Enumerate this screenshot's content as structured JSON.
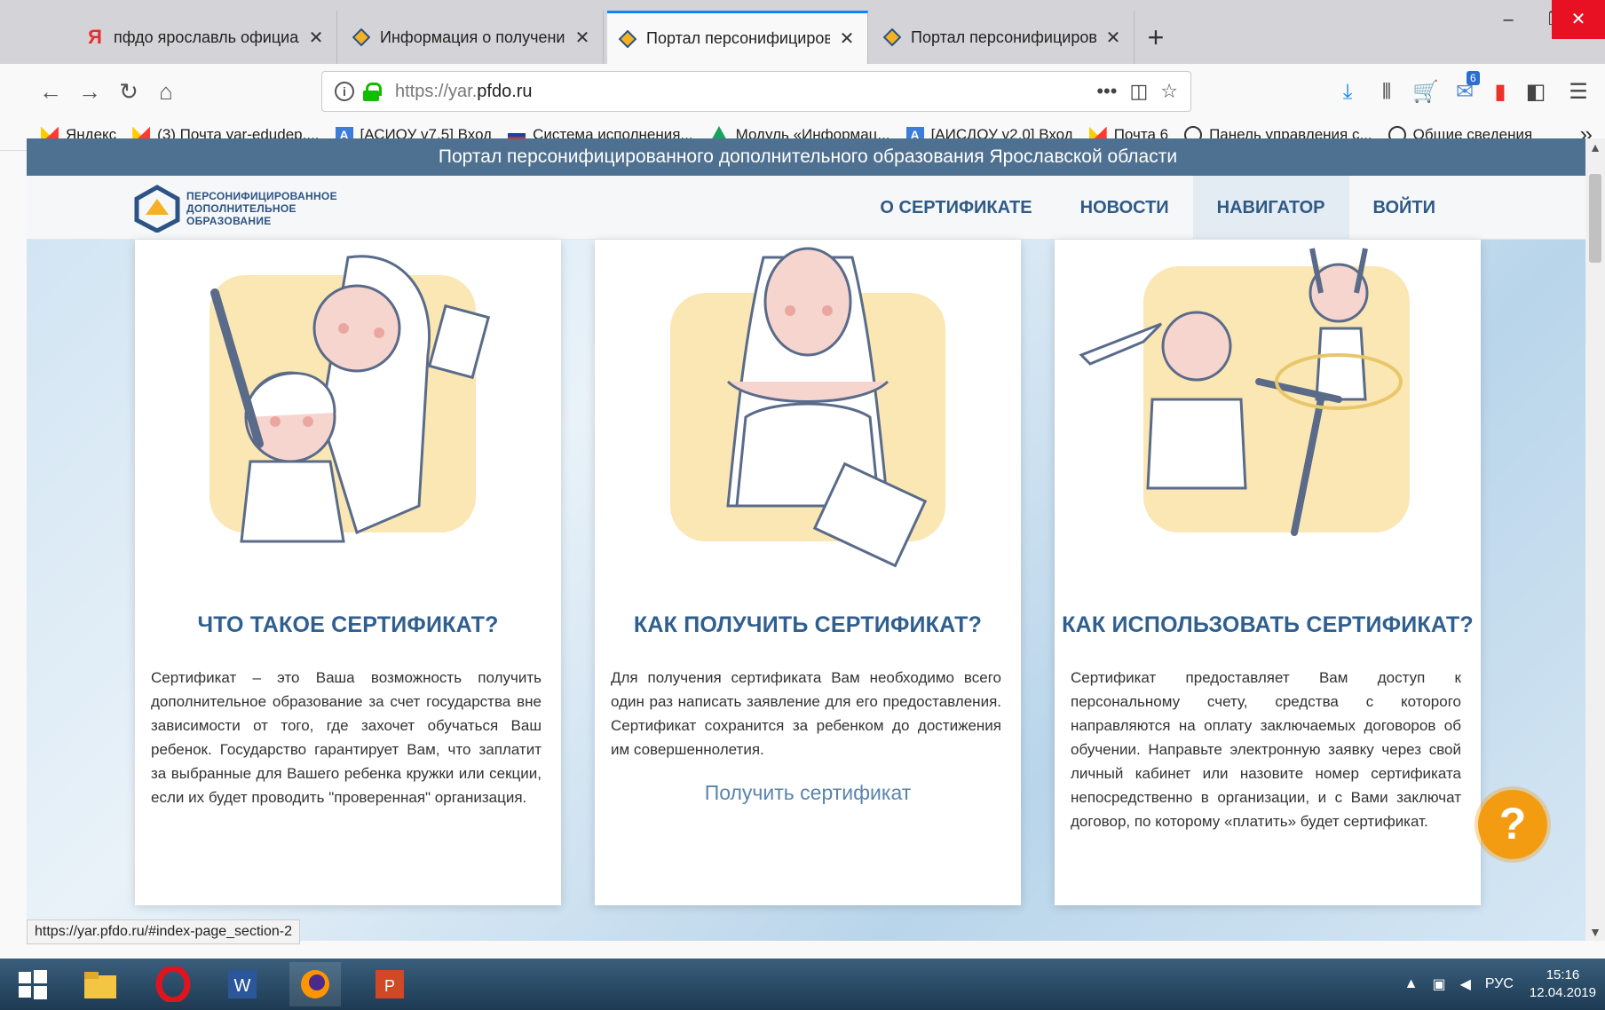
{
  "browser": {
    "tabs": [
      {
        "title": "пфдо ярославль официальный",
        "active": false
      },
      {
        "title": "Информация о получении сер",
        "active": false
      },
      {
        "title": "Портал персонифицированн",
        "active": true
      },
      {
        "title": "Портал персонифицированн",
        "active": false
      }
    ],
    "url_prefix": "https://yar.",
    "url_domain": "pfdo.ru",
    "bookmarks": [
      "Яндекс",
      "(3) Почта yar-edudep....",
      "[АСИОУ v7.5] Вход",
      "Система исполнения...",
      "Модуль «Информац...",
      "[АИСДОУ v2.0] Вход",
      "Почта 6",
      "Панель управления с...",
      "Общие сведения"
    ],
    "mail_badge": "6",
    "status_url": "https://yar.pfdo.ru/#index-page_section-2"
  },
  "site": {
    "banner": "Портал персонифицированного дополнительного образования Ярославской области",
    "logo_lines": [
      "ПЕРСОНИФИЦИРОВАННОЕ",
      "ДОПОЛНИТЕЛЬНОЕ",
      "ОБРАЗОВАНИЕ"
    ],
    "menu": [
      "О СЕРТИФИКАТЕ",
      "НОВОСТИ",
      "НАВИГАТОР",
      "ВОЙТИ"
    ],
    "active_menu": "НАВИГАТОР",
    "cards": [
      {
        "title": "ЧТО ТАКОЕ СЕРТИФИКАТ?",
        "text": "Сертификат – это Ваша возможность получить дополнительное образование за счет государства вне зависимости от того, где захочет обучаться Ваш ребенок. Государство гарантирует Вам, что заплатит за выбранные для Вашего ребенка кружки или секции, если их будет проводить \"проверенная\" организация."
      },
      {
        "title": "КАК ПОЛУЧИТЬ СЕРТИФИКАТ?",
        "text": "Для получения сертификата Вам необходимо всего один раз написать заявление для его предоставления. Сертификат сохранится за ребенком до достижения им совершеннолетия.",
        "cta": "Получить сертификат"
      },
      {
        "title": "КАК ИСПОЛЬЗОВАТЬ СЕРТИФИКАТ?",
        "text": "Сертификат предоставляет Вам доступ к персональному счету, средства с которого направляются на оплату заключаемых договоров об обучении. Направьте электронную заявку через свой личный кабинет или назовите номер сертификата непосредственно в организации, и с Вами заключат договор, по которому «платить» будет сертификат."
      }
    ],
    "help_label": "?"
  },
  "taskbar": {
    "language": "РУС",
    "time": "15:16",
    "date": "12.04.2019"
  },
  "colors": {
    "accent": "#0a84ff",
    "banner_bg": "#4f7191",
    "heading": "#2f5f8f",
    "help": "#f39c12",
    "illustration_bg": "#fbe7b3"
  }
}
